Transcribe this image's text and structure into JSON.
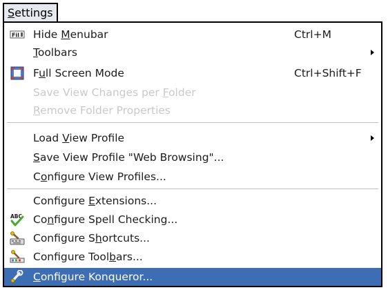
{
  "menu": {
    "title": "Settings",
    "title_accel": "S",
    "items": [
      {
        "pre": "Hide ",
        "acc": "M",
        "post": "enubar",
        "shortcut": "Ctrl+M",
        "icon": "fit-menubar-icon"
      },
      {
        "pre": "",
        "acc": "T",
        "post": "oolbars",
        "submenu": true
      },
      {
        "pre": "F",
        "acc": "u",
        "post": "ll Screen Mode",
        "shortcut": "Ctrl+Shift+F",
        "icon": "fullscreen-icon"
      },
      {
        "pre": "Save View Changes per ",
        "acc": "F",
        "post": "older",
        "disabled": true
      },
      {
        "pre": "",
        "acc": "R",
        "post": "emove Folder Properties",
        "disabled": true
      },
      {
        "pre": "Load ",
        "acc": "V",
        "post": "iew Profile",
        "submenu": true
      },
      {
        "pre": "",
        "acc": "S",
        "post": "ave View Profile \"Web Browsing\"..."
      },
      {
        "pre": "C",
        "acc": "o",
        "post": "nfigure View Profiles..."
      },
      {
        "pre": "Configure ",
        "acc": "E",
        "post": "xtensions..."
      },
      {
        "pre": "Co",
        "acc": "n",
        "post": "figure Spell Checking...",
        "icon": "spellcheck-icon"
      },
      {
        "pre": "Configure S",
        "acc": "h",
        "post": "ortcuts...",
        "icon": "keyboard-shortcuts-icon"
      },
      {
        "pre": "Configure Tool",
        "acc": "b",
        "post": "ars...",
        "icon": "configure-toolbars-icon"
      },
      {
        "pre": "",
        "acc": "C",
        "post": "onfigure Konqueror...",
        "icon": "configure-icon",
        "highlighted": true
      }
    ]
  },
  "colors": {
    "highlight": "#3d6eb4",
    "disabled_text": "#c9c9c9",
    "menubar_bg": "#e6e9ee"
  }
}
